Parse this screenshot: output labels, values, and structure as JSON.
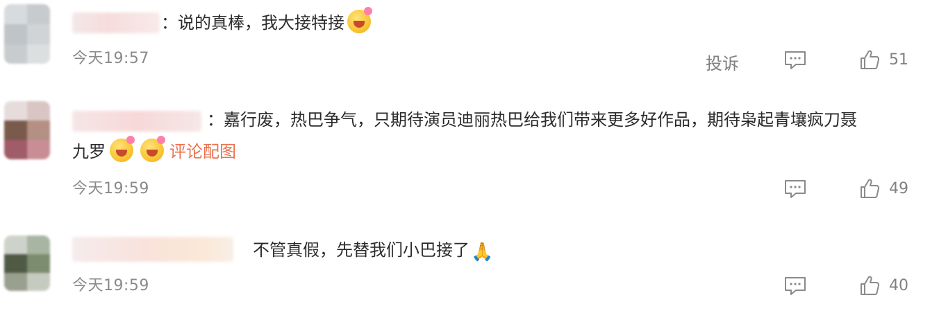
{
  "comments": [
    {
      "text": "：说的真棒，我大接特接",
      "emoji": "smile-emoji",
      "time": "今天19:57",
      "report": "投诉",
      "likes": "51"
    },
    {
      "text_line1": "：嘉行废，热巴争气，只期待演员迪丽热巴给我们带来更多好作品，期待枭起青壤疯刀聂",
      "text_line2": "九罗",
      "image_link": "评论配图",
      "time": "今天19:59",
      "likes": "49"
    },
    {
      "text": "不管真假，先替我们小巴接了",
      "emoji_char": "🙏",
      "time": "今天19:59",
      "likes": "40"
    }
  ]
}
